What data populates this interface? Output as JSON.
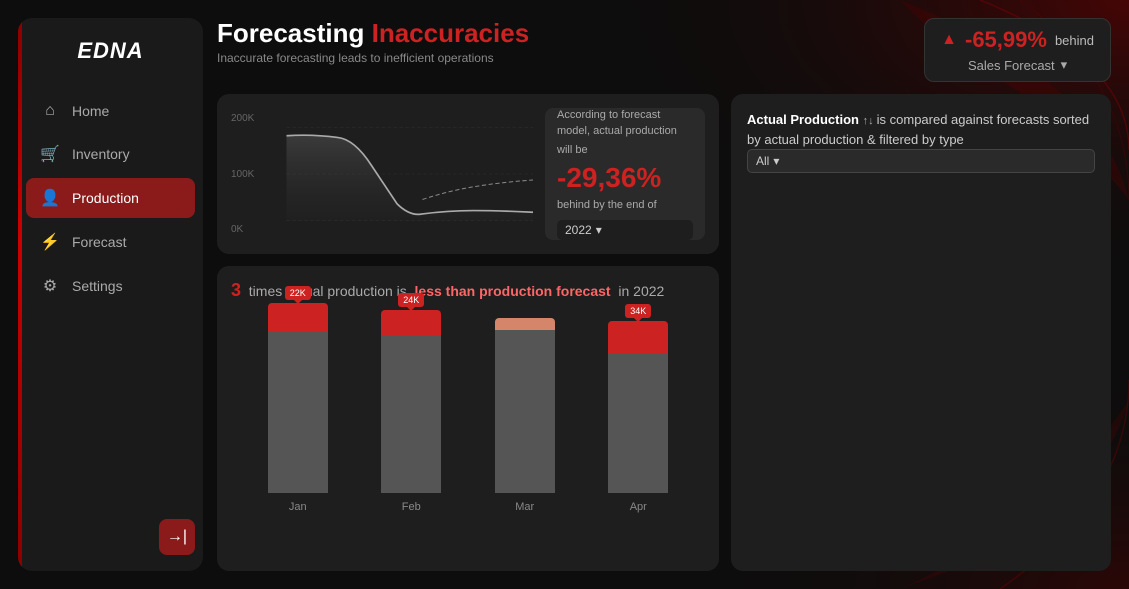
{
  "sidebar": {
    "logo": "EDNA",
    "nav_items": [
      {
        "id": "home",
        "label": "Home",
        "icon": "⌂",
        "active": false
      },
      {
        "id": "inventory",
        "label": "Inventory",
        "icon": "🛒",
        "active": false
      },
      {
        "id": "production",
        "label": "Production",
        "icon": "👤",
        "active": true
      },
      {
        "id": "forecast",
        "label": "Forecast",
        "icon": "⚡",
        "active": false
      },
      {
        "id": "settings",
        "label": "Settings",
        "icon": "⚙",
        "active": false
      }
    ],
    "logout_icon": "→|"
  },
  "header": {
    "title_static": "Forecasting",
    "title_highlight": "Inaccuracies",
    "subtitle": "Inaccurate forecasting leads to inefficient operations",
    "badge": {
      "percentage": "-65,99%",
      "behind_text": "behind",
      "dropdown_label": "Sales Forecast"
    }
  },
  "top_chart": {
    "y_labels": [
      "200K",
      "100K",
      "0K"
    ],
    "info": {
      "line1": "According to forecast model, actual production",
      "line2": "will be",
      "percentage": "-29,36%",
      "line3": "behind by the end of",
      "dropdown_label": "2022"
    }
  },
  "bottom_chart": {
    "title_num": "3",
    "title_text1": "times actual production is",
    "title_emphasis": "less than production forecast",
    "title_text2": "in 2022",
    "bars": [
      {
        "month": "Jan",
        "label": "22K",
        "red_height": 30,
        "main_height": 170,
        "type": "red"
      },
      {
        "month": "Feb",
        "label": "24K",
        "red_height": 28,
        "main_height": 165,
        "type": "red"
      },
      {
        "month": "Mar",
        "label": "",
        "red_height": 12,
        "main_height": 160,
        "type": "peach"
      },
      {
        "month": "Apr",
        "label": "34K",
        "red_height": 35,
        "main_height": 155,
        "type": "red"
      }
    ]
  },
  "right_panel": {
    "header_text1": "Actual Production",
    "header_icon": "↑↓",
    "header_text2": "is compared against forecasts sorted by actual production & filtered by type",
    "filter_label": "All"
  }
}
